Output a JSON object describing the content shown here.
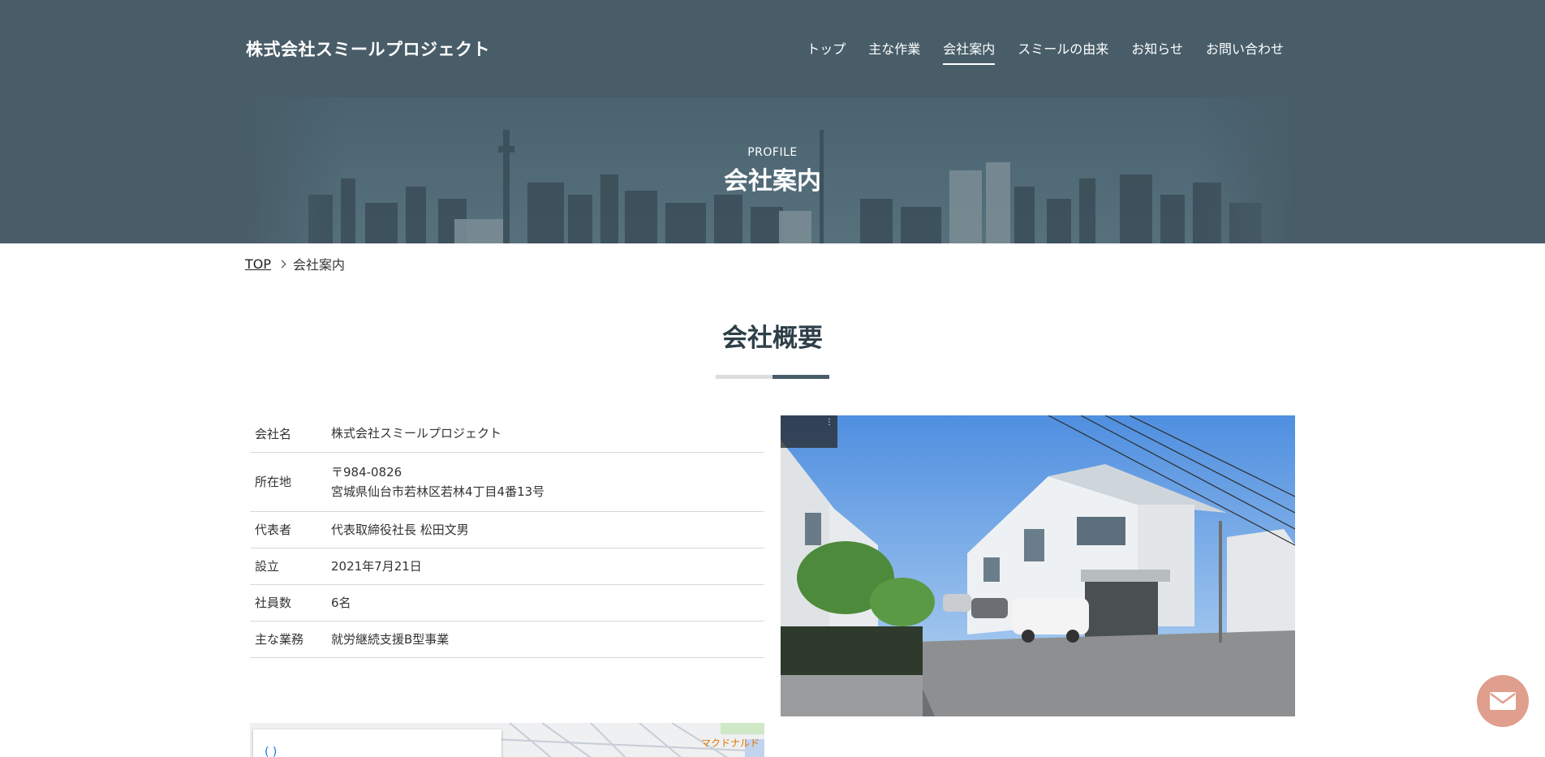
{
  "header": {
    "logo": "株式会社スミールプロジェクト",
    "nav": [
      {
        "label": "トップ",
        "name": "nav-top"
      },
      {
        "label": "主な作業",
        "name": "nav-works"
      },
      {
        "label": "会社案内",
        "name": "nav-profile",
        "active": true
      },
      {
        "label": "スミールの由来",
        "name": "nav-origin"
      },
      {
        "label": "お知らせ",
        "name": "nav-news"
      },
      {
        "label": "お問い合わせ",
        "name": "nav-contact"
      }
    ]
  },
  "hero": {
    "subtitle": "PROFILE",
    "title": "会社案内"
  },
  "breadcrumb": {
    "home": "TOP",
    "current": "会社案内"
  },
  "section": {
    "title": "会社概要"
  },
  "company_table": [
    {
      "label": "会社名",
      "value": "株式会社スミールプロジェクト"
    },
    {
      "label": "所在地",
      "value": "〒984-0826",
      "value2": "宮城県仙台市若林区若林4丁目4番13号"
    },
    {
      "label": "代表者",
      "value": "代表取締役社長 松田文男"
    },
    {
      "label": "設立",
      "value": "2021年7月21日"
    },
    {
      "label": "社員数",
      "value": "6名"
    },
    {
      "label": "主な業務",
      "value": "就労継続支援B型事業"
    }
  ],
  "map": {
    "poi_label": "マクドナルド"
  },
  "colors": {
    "header_bg": "#485d68",
    "accent": "#485d68",
    "fab": "#e09e8c"
  },
  "icons": {
    "contact": "mail-icon",
    "breadcrumb_separator": "chevron-right-icon"
  }
}
